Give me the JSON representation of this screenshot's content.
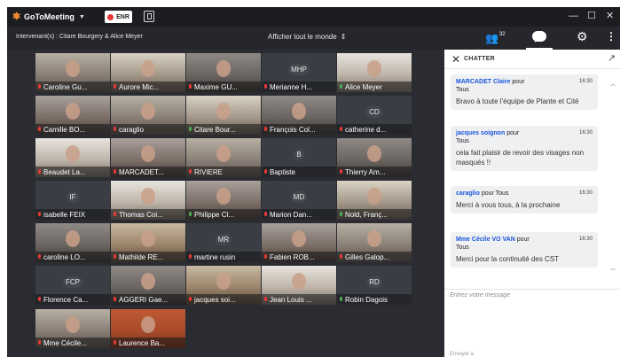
{
  "app": {
    "title": "GoToMeeting",
    "record_label": "ENR",
    "minimize_glyph": "—",
    "maximize_glyph": "☐",
    "close_glyph": "✕"
  },
  "infobar": {
    "speakers": "Intervenant(s) : Citare Bourgery & Alice Meyer",
    "view_label": "Afficher tout le monde",
    "participants_count": "32"
  },
  "icons": {
    "logo": "gotomeeting-logo-icon",
    "record": "record-dot-icon",
    "screen_share": "screen-share-icon",
    "people": "people-icon",
    "chat": "chat-bubble-icon",
    "settings": "gear-icon",
    "more": "kebab-icon",
    "chat_close": "close-icon",
    "popout": "popout-icon"
  },
  "colors": {
    "brand_orange": "#f68d2e",
    "record_red": "#e53935",
    "mic_muted": "#e53935",
    "mic_active": "#4caf50",
    "sender_blue": "#1a56db"
  },
  "grid": {
    "tiles": [
      {
        "name": "Caroline Gu...",
        "mic": "muted",
        "initials": ""
      },
      {
        "name": "Aurore Mic...",
        "mic": "muted",
        "initials": ""
      },
      {
        "name": "Maxime GU...",
        "mic": "muted",
        "initials": ""
      },
      {
        "name": "Merianne H...",
        "mic": "muted",
        "initials": "MHP"
      },
      {
        "name": "Alice Meyer",
        "mic": "active",
        "initials": ""
      },
      {
        "name": "Camille BO...",
        "mic": "muted",
        "initials": ""
      },
      {
        "name": "caraglio",
        "mic": "muted",
        "initials": ""
      },
      {
        "name": "Citare Bour...",
        "mic": "active",
        "initials": ""
      },
      {
        "name": "François Col...",
        "mic": "muted",
        "initials": ""
      },
      {
        "name": "catherine d...",
        "mic": "muted",
        "initials": "CD"
      },
      {
        "name": "Beaudet La...",
        "mic": "muted",
        "initials": ""
      },
      {
        "name": "MARCADET...",
        "mic": "muted",
        "initials": ""
      },
      {
        "name": "RIVIERE",
        "mic": "muted",
        "initials": ""
      },
      {
        "name": "Baptiste",
        "mic": "muted",
        "initials": "B"
      },
      {
        "name": "Thierry Am...",
        "mic": "muted",
        "initials": ""
      },
      {
        "name": "isabelle FEIX",
        "mic": "muted",
        "initials": "IF"
      },
      {
        "name": "Thomas Coi...",
        "mic": "muted",
        "initials": ""
      },
      {
        "name": "Philippe Cl...",
        "mic": "active",
        "initials": ""
      },
      {
        "name": "Marion Dan...",
        "mic": "muted",
        "initials": "MD"
      },
      {
        "name": "Nold, Franç...",
        "mic": "active",
        "initials": ""
      },
      {
        "name": "caroline LO...",
        "mic": "muted",
        "initials": ""
      },
      {
        "name": "Mathilde RE...",
        "mic": "muted",
        "initials": ""
      },
      {
        "name": "martine rusin",
        "mic": "muted",
        "initials": "MR"
      },
      {
        "name": "Fabien ROB...",
        "mic": "muted",
        "initials": ""
      },
      {
        "name": "Gilles Galop...",
        "mic": "muted",
        "initials": ""
      },
      {
        "name": "Florence Ca...",
        "mic": "muted",
        "initials": "FCP"
      },
      {
        "name": "AGGERI Gae...",
        "mic": "muted",
        "initials": ""
      },
      {
        "name": "jacques soi...",
        "mic": "muted",
        "initials": ""
      },
      {
        "name": "Jean Louis ...",
        "mic": "muted",
        "initials": ""
      },
      {
        "name": "Robin Dagois",
        "mic": "active",
        "initials": "RD"
      },
      {
        "name": "Mme Cécile...",
        "mic": "muted",
        "initials": ""
      },
      {
        "name": "Laurence Ba...",
        "mic": "muted",
        "initials": ""
      }
    ]
  },
  "chat": {
    "title": "CHATTER",
    "messages": [
      {
        "sender": "MARCADET Claire",
        "to_prefix": "pour",
        "to": "Tous",
        "time": "16:30",
        "text": "Bravo à toute l'équipe de Plante et Cité"
      },
      {
        "sender": "jacques soignon",
        "to_prefix": "pour",
        "to": "Tous",
        "time": "16:30",
        "text": "cela fait plaisir de revoir des visages non masqués !!"
      },
      {
        "sender": "caraglio",
        "to_prefix": "pour",
        "to": "Tous",
        "time": "16:30",
        "text": "Merci à vous tous, à la prochaine"
      },
      {
        "sender": "Mme Cécile VO VAN",
        "to_prefix": "pour",
        "to": "Tous",
        "time": "16:30",
        "text": "Merci pour la continuité des CST"
      }
    ],
    "compose_placeholder": "Entrez votre message",
    "send_label": "Envoyer à"
  }
}
